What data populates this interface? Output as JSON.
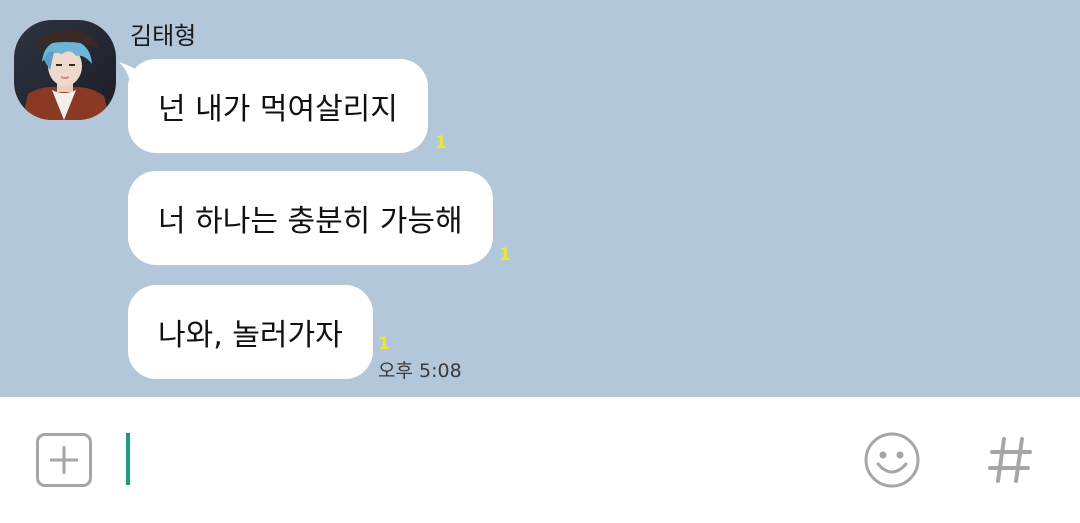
{
  "chat": {
    "sender_name": "김태형",
    "messages": [
      {
        "text": "넌 내가 먹여살리지",
        "read_count": "1"
      },
      {
        "text": "너 하나는 충분히 가능해",
        "read_count": "1"
      },
      {
        "text": "나와, 놀러가자",
        "read_count": "1"
      }
    ],
    "timestamp": "오후 5:08"
  },
  "input_bar": {
    "message_value": "",
    "icons": {
      "plus": "add-icon",
      "emoji": "smiley-face-icon",
      "hash": "hashtag-icon"
    }
  },
  "colors": {
    "chat_background": "#b2c7da",
    "bubble": "#ffffff",
    "read_count": "#f2e532",
    "caret": "#1b9c87",
    "icon_gray": "#a6a6a6"
  }
}
